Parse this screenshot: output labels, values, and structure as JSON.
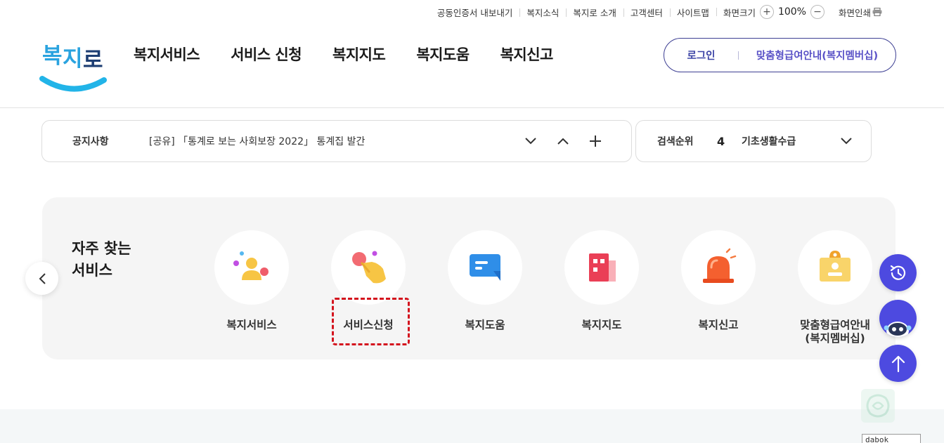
{
  "utility_bar": {
    "items": [
      "공동인증서 내보내기",
      "복지소식",
      "복지로 소개",
      "고객센터",
      "사이트맵"
    ],
    "zoom_label": "화면크기",
    "zoom_in": "+",
    "zoom_out": "−",
    "zoom_value": "100%",
    "print": "화면인쇄"
  },
  "header": {
    "logo_text": "복지로",
    "nav": [
      "복지서비스",
      "서비스 신청",
      "복지지도",
      "복지도움",
      "복지신고"
    ],
    "login": "로그인",
    "membership": "맞춤형급여안내(복지멤버십)"
  },
  "notice": {
    "label": "공지사항",
    "text": "[공유] 「통계로 보는 사회보장 2022」 통계집 발간"
  },
  "search_rank": {
    "label": "검색순위",
    "rank": "4",
    "keyword": "기초생활수급"
  },
  "frequent": {
    "title_line1": "자주 찾는",
    "title_line2": "서비스",
    "services": [
      {
        "label": "복지서비스",
        "icon": "person-icon"
      },
      {
        "label": "서비스신청",
        "icon": "hand-touch-icon"
      },
      {
        "label": "복지도움",
        "icon": "chat-bubble-icon"
      },
      {
        "label": "복지지도",
        "icon": "building-map-icon"
      },
      {
        "label": "복지신고",
        "icon": "siren-icon"
      },
      {
        "label_line1": "맞춤형급여안내",
        "label_line2": "(복지멤버십)",
        "icon": "id-card-icon"
      }
    ]
  },
  "footer": {
    "badge": "dabok"
  },
  "colors": {
    "brand_navy": "#3d3f93",
    "brand_purple": "#5a52c7",
    "float_button": "#4d4ae0",
    "focus_outline": "#d4141e"
  }
}
